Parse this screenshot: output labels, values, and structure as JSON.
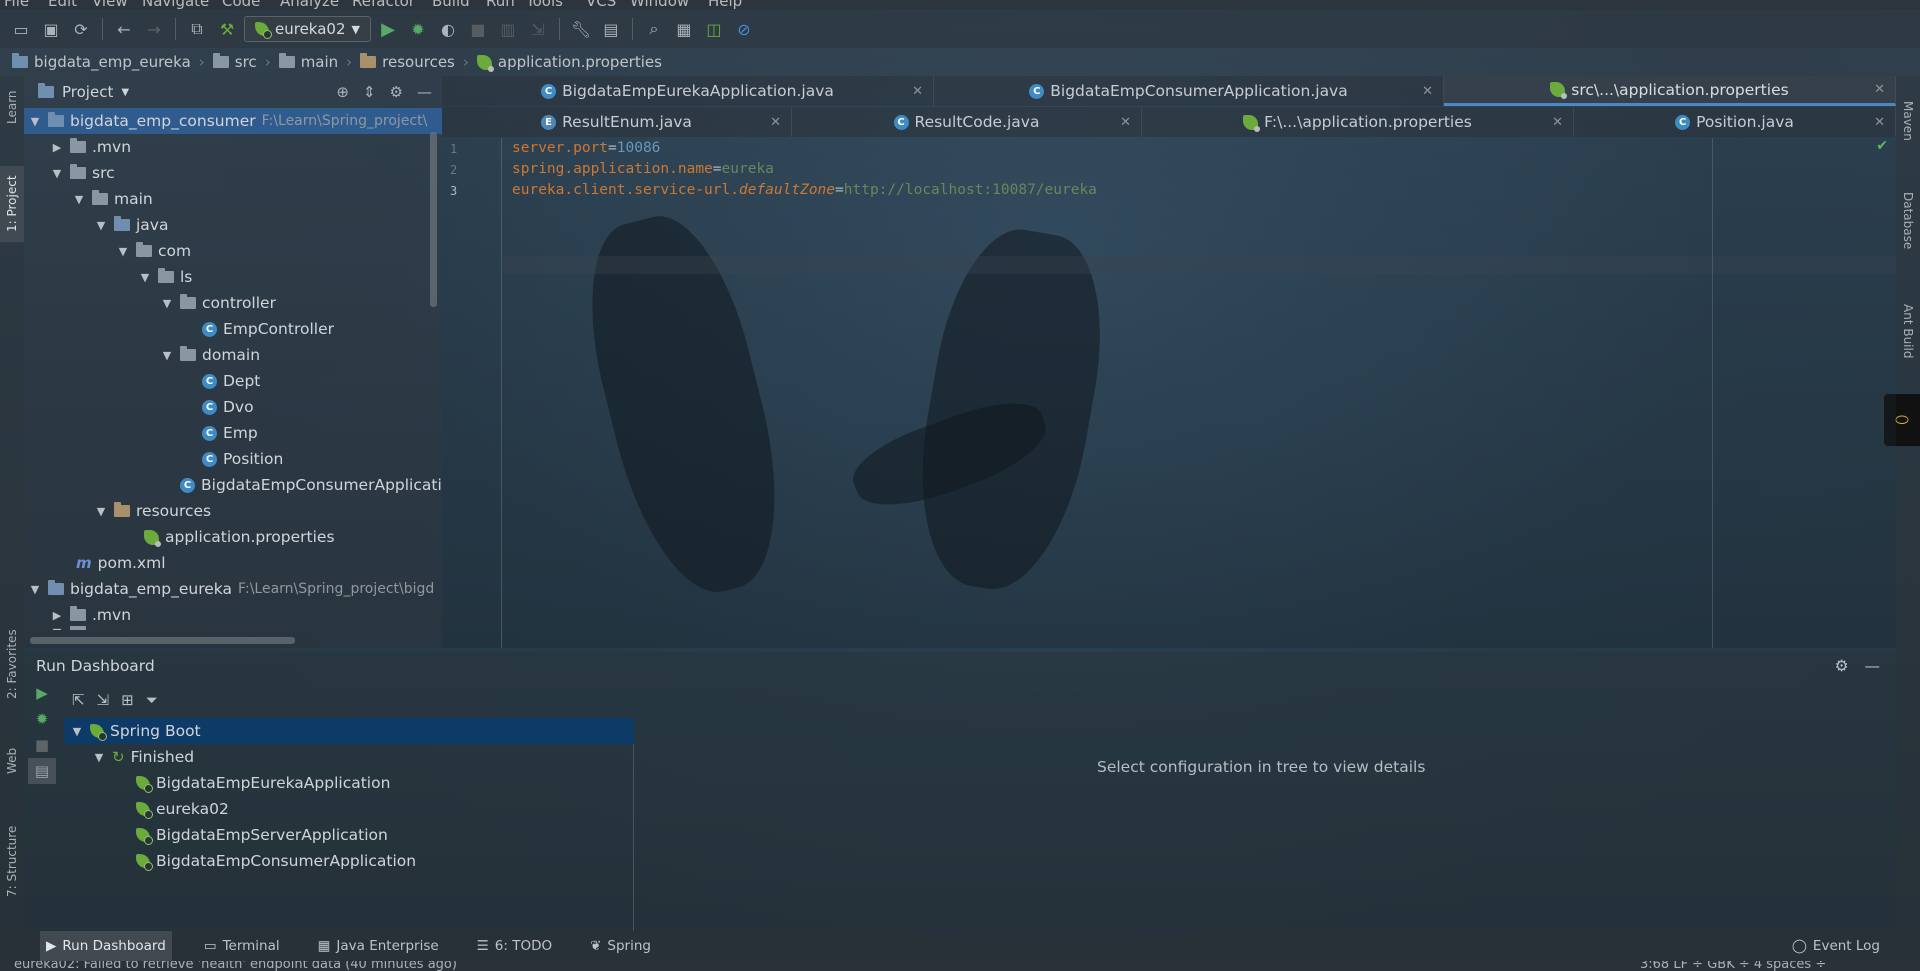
{
  "menu": [
    "File",
    "Edit",
    "View",
    "Navigate",
    "Code",
    "Analyze",
    "Refactor",
    "Build",
    "Run",
    "Tools",
    "VCS",
    "Window",
    "Help"
  ],
  "toolbar": {
    "run_config": "eureka02"
  },
  "breadcrumb": [
    "bigdata_emp_eureka",
    "src",
    "main",
    "resources",
    "application.properties"
  ],
  "left_strip": {
    "learn": "Learn",
    "project": "1: Project",
    "favorites": "2: Favorites",
    "web": "Web",
    "structure": "7: Structure"
  },
  "right_strip": {
    "maven": "Maven",
    "database": "Database",
    "ant": "Ant Build"
  },
  "project": {
    "title": "Project",
    "rows": [
      {
        "label": "bigdata_emp_consumer",
        "hint": "F:\\Learn\\Spring_project\\"
      },
      {
        "label": ".mvn"
      },
      {
        "label": "src"
      },
      {
        "label": "main"
      },
      {
        "label": "java"
      },
      {
        "label": "com"
      },
      {
        "label": "ls"
      },
      {
        "label": "controller"
      },
      {
        "label": "EmpController"
      },
      {
        "label": "domain"
      },
      {
        "label": "Dept"
      },
      {
        "label": "Dvo"
      },
      {
        "label": "Emp"
      },
      {
        "label": "Position"
      },
      {
        "label": "BigdataEmpConsumerApplication"
      },
      {
        "label": "resources"
      },
      {
        "label": "application.properties"
      },
      {
        "label": "pom.xml"
      },
      {
        "label": "bigdata_emp_eureka",
        "hint": "F:\\Learn\\Spring_project\\bigd"
      },
      {
        "label": ".mvn"
      },
      {
        "label": "src"
      }
    ]
  },
  "editor": {
    "tabs_row1": [
      "BigdataEmpEurekaApplication.java",
      "BigdataEmpConsumerApplication.java",
      "src\\...\\application.properties"
    ],
    "tabs_row2": [
      "ResultEnum.java",
      "ResultCode.java",
      "F:\\...\\application.properties",
      "Position.java"
    ],
    "line_numbers": [
      "1",
      "2",
      "3"
    ],
    "code": {
      "l1_key": "server.port",
      "l1_val": "10086",
      "l2_key": "spring.application.name",
      "l2_val": "eureka",
      "l3_key": "eureka.client.service-url.",
      "l3_key_italic": "defaultZone",
      "l3_val": "http://localhost:10087/eureka",
      "eq": "="
    }
  },
  "run_dashboard": {
    "title": "Run Dashboard",
    "tree": {
      "root": "Spring Boot",
      "group": "Finished",
      "apps": [
        "BigdataEmpEurekaApplication",
        "eureka02",
        "BigdataEmpServerApplication",
        "BigdataEmpConsumerApplication"
      ]
    },
    "detail_message": "Select configuration in tree to view details"
  },
  "bottom_tabs": {
    "run_dashboard": "Run Dashboard",
    "terminal": "Terminal",
    "java_enterprise": "Java Enterprise",
    "todo": "6: TODO",
    "spring": "Spring",
    "event_log": "Event Log"
  },
  "status": {
    "message": "eureka02: Failed to retrieve 'health' endpoint data (40 minutes ago)",
    "right": "3:68   LF ÷   GBK ÷   4 spaces ÷"
  }
}
